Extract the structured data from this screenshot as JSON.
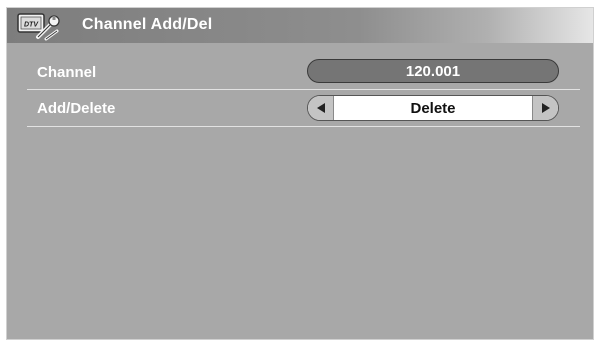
{
  "window": {
    "title": "Channel Add/Del",
    "icon": "dtv-settings-icon",
    "icon_text": "DTV"
  },
  "settings": {
    "channel": {
      "label": "Channel",
      "value": "120.001"
    },
    "add_delete": {
      "label": "Add/Delete",
      "value": "Delete",
      "left_arrow": "triangle-left-icon",
      "right_arrow": "triangle-right-icon"
    }
  },
  "colors": {
    "panel": "#a8a8a8",
    "title_bar": "#7d7d7d",
    "value_pill": "#757575",
    "text": "#ffffff"
  }
}
